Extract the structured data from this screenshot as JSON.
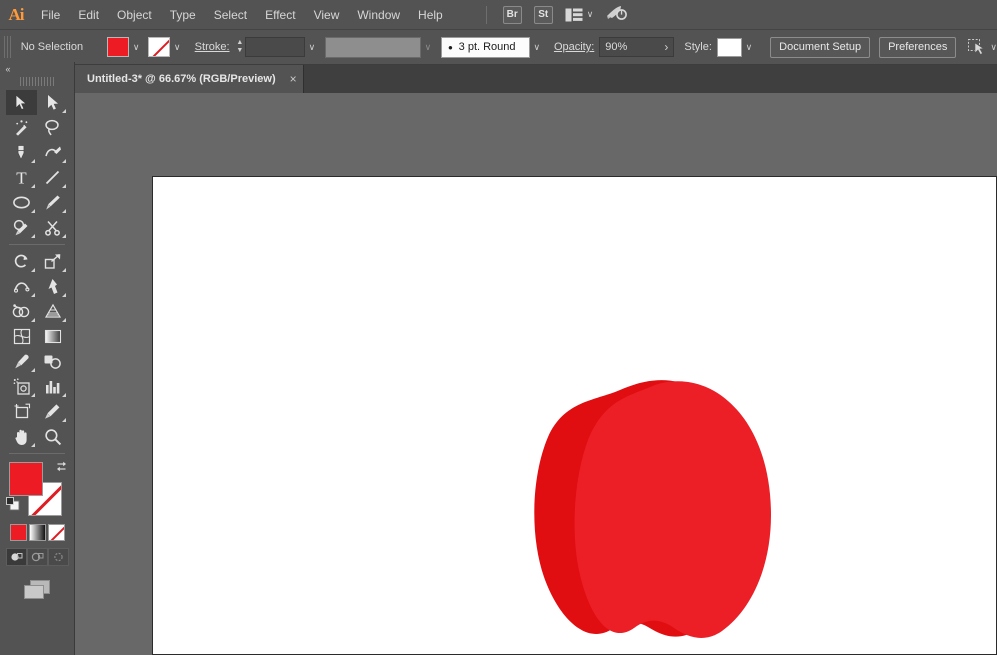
{
  "app": {
    "name": "Adobe Illustrator",
    "logo_text": "Ai"
  },
  "menubar": {
    "items": [
      {
        "label": "File"
      },
      {
        "label": "Edit"
      },
      {
        "label": "Object"
      },
      {
        "label": "Type"
      },
      {
        "label": "Select"
      },
      {
        "label": "Effect"
      },
      {
        "label": "View"
      },
      {
        "label": "Window"
      },
      {
        "label": "Help"
      }
    ],
    "right": {
      "bridge_label": "Br",
      "stock_label": "St",
      "workspace_icon": "workspace-switcher-icon",
      "workspace_chevron": "∨",
      "search_icon": "search-rocket-icon"
    }
  },
  "controlbar": {
    "selection_status": "No Selection",
    "fill_icon": "fill-swatch-icon",
    "fill_color": "#ED1C24",
    "fill_chevron": "∨",
    "stroke_swatch_icon": "stroke-none-swatch-icon",
    "stroke_swatch_chevron": "∨",
    "stroke_label": "Stroke:",
    "stroke_stepper_up": "▲",
    "stroke_stepper_down": "▼",
    "stroke_weight_value": "",
    "stroke_weight_chevron": "∨",
    "stroke_profile_value": "",
    "stroke_profile_chevron": "∨",
    "brush_bullet": "•",
    "brush_definition": "3 pt. Round",
    "brush_chevron": "∨",
    "opacity_label": "Opacity:",
    "opacity_value": "90%",
    "opacity_arrow": "›",
    "style_label": "Style:",
    "style_chevron": "∨",
    "document_setup_label": "Document Setup",
    "preferences_label": "Preferences",
    "align_icon": "align-to-artboard-icon",
    "align_chevron": "∨"
  },
  "tabbar": {
    "tabs": [
      {
        "title": "Untitled-3* @ 66.67% (RGB/Preview)",
        "close": "×",
        "active": true
      }
    ]
  },
  "toolbar": {
    "collapse_icon": "«",
    "tools": [
      {
        "name": "selection-tool",
        "label": "Selection",
        "active": true,
        "more": false
      },
      {
        "name": "direct-selection-tool",
        "label": "Direct Selection",
        "active": false,
        "more": true
      },
      {
        "name": "magic-wand-tool",
        "label": "Magic Wand",
        "active": false,
        "more": false
      },
      {
        "name": "lasso-tool",
        "label": "Lasso",
        "active": false,
        "more": false
      },
      {
        "name": "pen-tool",
        "label": "Pen",
        "active": false,
        "more": true
      },
      {
        "name": "curvature-tool",
        "label": "Curvature",
        "active": false,
        "more": false
      },
      {
        "name": "type-tool",
        "label": "Type",
        "active": false,
        "more": true
      },
      {
        "name": "line-segment-tool",
        "label": "Line Segment",
        "active": false,
        "more": true
      },
      {
        "name": "ellipse-tool",
        "label": "Ellipse",
        "active": false,
        "more": true
      },
      {
        "name": "paintbrush-tool",
        "label": "Paintbrush",
        "active": false,
        "more": true
      },
      {
        "name": "shaper-pencil-tool",
        "label": "Shaper",
        "active": false,
        "more": true
      },
      {
        "name": "scissors-tool",
        "label": "Scissors",
        "active": false,
        "more": true
      },
      {
        "name": "rotate-tool",
        "label": "Rotate",
        "active": false,
        "more": true
      },
      {
        "name": "scale-tool",
        "label": "Scale",
        "active": false,
        "more": true
      },
      {
        "name": "width-tool",
        "label": "Width",
        "active": false,
        "more": true
      },
      {
        "name": "free-transform-tool",
        "label": "Free Transform",
        "active": false,
        "more": true
      },
      {
        "name": "shape-builder-tool",
        "label": "Shape Builder",
        "active": false,
        "more": true
      },
      {
        "name": "perspective-grid-tool",
        "label": "Perspective Grid",
        "active": false,
        "more": true
      },
      {
        "name": "mesh-tool",
        "label": "Mesh",
        "active": false,
        "more": false
      },
      {
        "name": "gradient-tool",
        "label": "Gradient",
        "active": false,
        "more": false
      },
      {
        "name": "eyedropper-tool",
        "label": "Eyedropper",
        "active": false,
        "more": true
      },
      {
        "name": "blend-tool",
        "label": "Blend",
        "active": false,
        "more": false
      },
      {
        "name": "symbol-sprayer-tool",
        "label": "Symbol Sprayer",
        "active": false,
        "more": true
      },
      {
        "name": "column-graph-tool",
        "label": "Column Graph",
        "active": false,
        "more": true
      },
      {
        "name": "artboard-tool",
        "label": "Artboard",
        "active": false,
        "more": false
      },
      {
        "name": "slice-tool",
        "label": "Slice",
        "active": false,
        "more": true
      },
      {
        "name": "hand-tool",
        "label": "Hand",
        "active": false,
        "more": true
      },
      {
        "name": "zoom-tool",
        "label": "Zoom",
        "active": false,
        "more": false
      }
    ],
    "fill_color": "#ED1C24",
    "stroke_color": "none",
    "swap_icon": "swap-fill-stroke-icon",
    "default_icon": "default-fill-stroke-icon",
    "modes": [
      {
        "name": "color-mode-swatch",
        "label": "Color"
      },
      {
        "name": "gradient-mode-swatch",
        "label": "Gradient"
      },
      {
        "name": "none-mode-swatch",
        "label": "None"
      }
    ],
    "draw_modes": [
      {
        "name": "draw-normal-mode",
        "label": "Draw Normal",
        "active": true
      },
      {
        "name": "draw-behind-mode",
        "label": "Draw Behind",
        "active": false
      },
      {
        "name": "draw-inside-mode",
        "label": "Draw Inside",
        "active": false
      }
    ],
    "screen_mode_icon": "change-screen-mode-icon"
  },
  "canvas": {
    "background_color": "#686868",
    "artboard_color": "#ffffff",
    "artwork": {
      "name": "apple-shape",
      "back_color": "#E00D11",
      "front_color": "#EC1F26"
    }
  }
}
